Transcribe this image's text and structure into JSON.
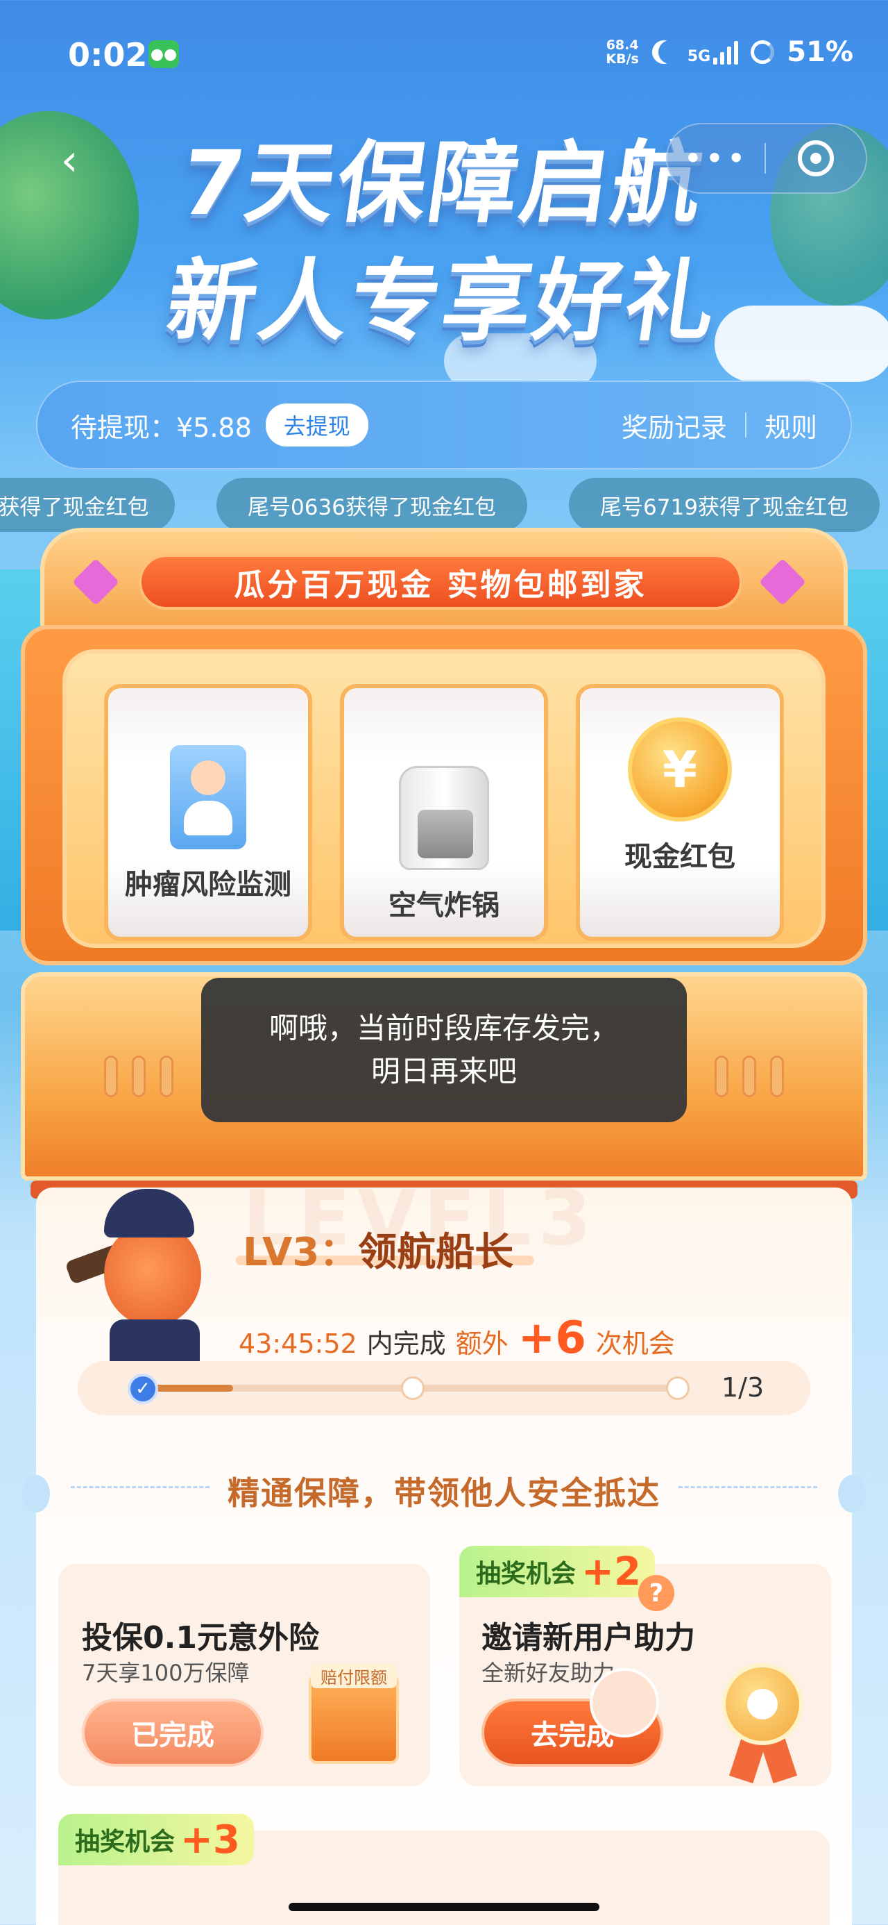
{
  "status_bar": {
    "time": "0:02",
    "net_speed_value": "68.4",
    "net_speed_unit": "KB/s",
    "network": "5G",
    "battery": "51%"
  },
  "header": {
    "headline_line1": "7天保障启航",
    "headline_line2": "新人专享好礼",
    "more_icon": "more-dots-icon",
    "target_icon": "target-icon"
  },
  "withdraw": {
    "label": "待提现：¥5.88",
    "button": "去提现",
    "records": "奖励记录",
    "rules": "规则"
  },
  "ticker": [
    "获得了现金红包",
    "尾号0636获得了现金红包",
    "尾号6719获得了现金红包"
  ],
  "slot_machine": {
    "banner": "瓜分百万现金 实物包邮到家",
    "reels": [
      {
        "label": "肿瘤风险监测",
        "icon": "health-card-icon"
      },
      {
        "label": "空气炸锅",
        "icon": "air-fryer-icon"
      },
      {
        "label": "现金红包",
        "icon": "yen-coin-icon",
        "symbol": "¥"
      }
    ]
  },
  "toast": {
    "line1": "啊哦，当前时段库存发完，",
    "line2": "明日再来吧"
  },
  "level": {
    "watermark": "LEVEL3",
    "title_prefix": "LV3：",
    "title": "领航船长",
    "timer": "43:45:52",
    "complete_text": "内完成",
    "extra_text": "额外",
    "plus": "+6",
    "chance_text": "次机会",
    "progress_text": "1/3",
    "progress_fraction": 0.1667,
    "check_mark": "✓"
  },
  "section": {
    "title": "精通保障，带领他人安全抵达"
  },
  "tasks": [
    {
      "title": "投保0.1元意外险",
      "subtitle": "7天享100万保障",
      "button": "已完成",
      "badge": "赔付限额"
    },
    {
      "tag": "抽奖机会",
      "tag_plus": "+2",
      "title": "邀请新用户助力",
      "subtitle": "全新好友助力",
      "button": "去完成",
      "question": "?"
    }
  ],
  "third_task": {
    "tag": "抽奖机会",
    "tag_plus": "+3"
  }
}
